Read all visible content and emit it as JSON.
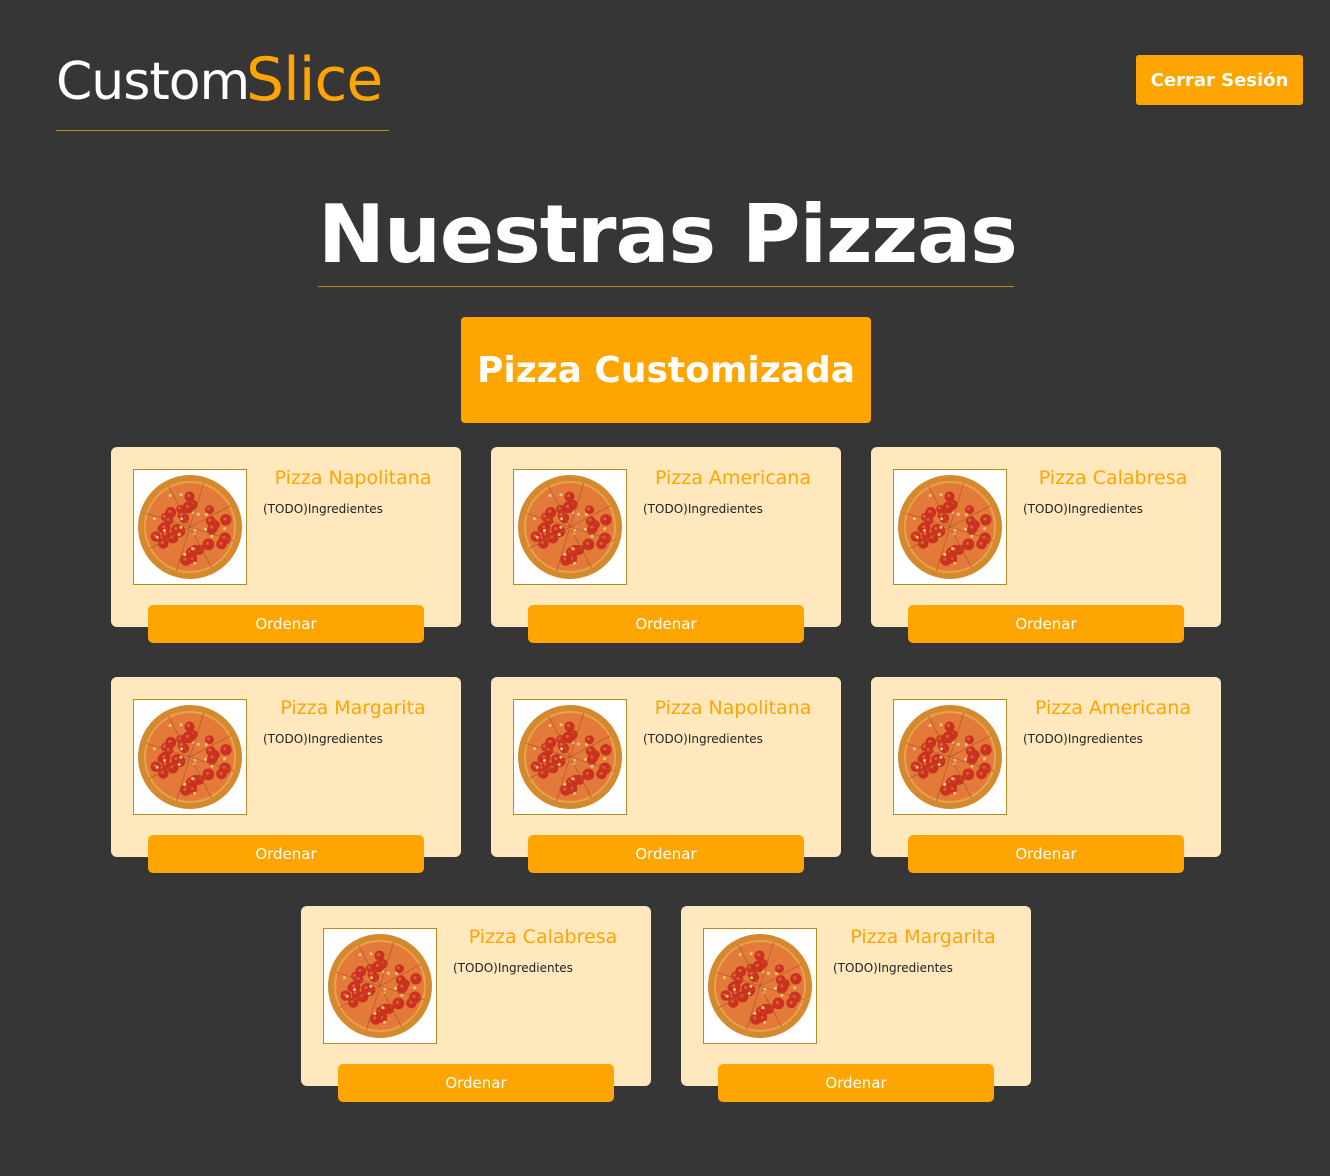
{
  "header": {
    "logo_part1": "Custom",
    "logo_part2": "Slice",
    "logout_label": "Cerrar Sesión"
  },
  "main": {
    "title": "Nuestras Pizzas",
    "custom_button_label": "Pizza Customizada"
  },
  "colors": {
    "background": "#363636",
    "accent": "#ffa502",
    "card_background": "#ffe8bd",
    "border": "#b98a22"
  },
  "pizzas": [
    {
      "name": "Pizza Napolitana",
      "description": "(TODO)Ingredientes",
      "order_label": "Ordenar",
      "image_icon": "pizza-image"
    },
    {
      "name": "Pizza Americana",
      "description": "(TODO)Ingredientes",
      "order_label": "Ordenar",
      "image_icon": "pizza-image"
    },
    {
      "name": "Pizza Calabresa",
      "description": "(TODO)Ingredientes",
      "order_label": "Ordenar",
      "image_icon": "pizza-image"
    },
    {
      "name": "Pizza Margarita",
      "description": "(TODO)Ingredientes",
      "order_label": "Ordenar",
      "image_icon": "pizza-image"
    },
    {
      "name": "Pizza Napolitana",
      "description": "(TODO)Ingredientes",
      "order_label": "Ordenar",
      "image_icon": "pizza-image"
    },
    {
      "name": "Pizza Americana",
      "description": "(TODO)Ingredientes",
      "order_label": "Ordenar",
      "image_icon": "pizza-image"
    },
    {
      "name": "Pizza Calabresa",
      "description": "(TODO)Ingredientes",
      "order_label": "Ordenar",
      "image_icon": "pizza-image"
    },
    {
      "name": "Pizza Margarita",
      "description": "(TODO)Ingredientes",
      "order_label": "Ordenar",
      "image_icon": "pizza-image"
    }
  ]
}
